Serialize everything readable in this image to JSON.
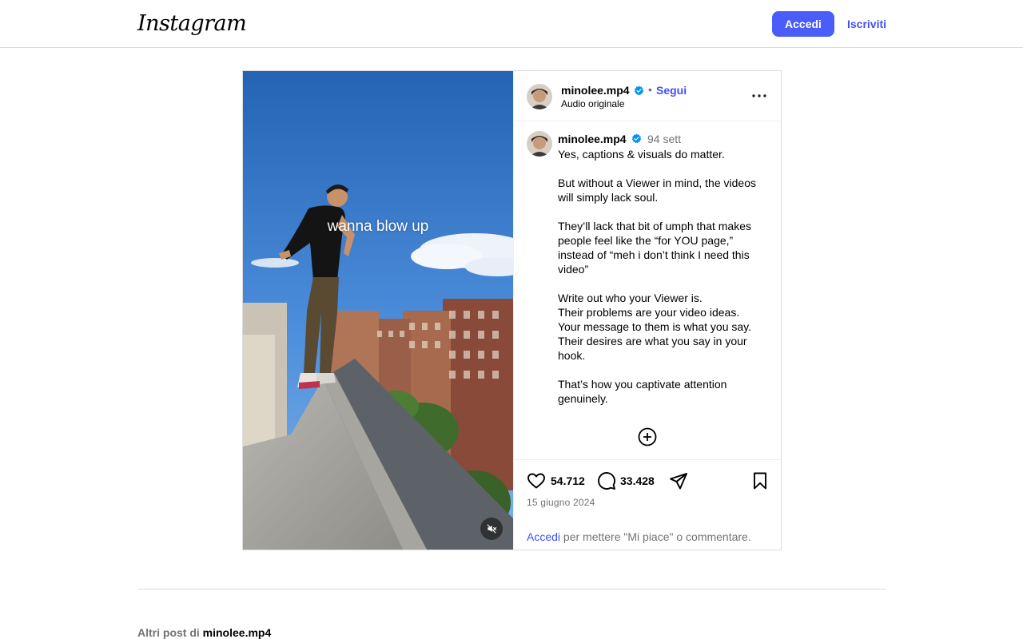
{
  "header": {
    "logo_text": "Instagram",
    "login_label": "Accedi",
    "signup_label": "Iscriviti"
  },
  "post": {
    "overlay_text": "wanna blow up",
    "author": {
      "username": "minolee.mp4",
      "verified": true,
      "follow_label": "Segui",
      "audio_label": "Audio originale"
    },
    "caption": {
      "username": "minolee.mp4",
      "time": "94 sett",
      "text": "Yes, captions & visuals do matter.\n\nBut without a Viewer in mind, the videos will simply lack soul.\n\nThey’ll lack that bit of umph that makes people feel like the “for YOU page,” instead of “meh i don’t think I need this video”\n\nWrite out who your Viewer is.\nTheir problems are your video ideas.\nYour message to them is what you say.\nTheir desires are what you say in your hook.\n\nThat’s how you captivate attention genuinely."
    },
    "likes": "54.712",
    "comments": "33.428",
    "date": "15 giugno 2024",
    "login_prompt": {
      "link": "Accedi",
      "rest": " per mettere \"Mi piace\" o commentare."
    }
  },
  "more_posts": {
    "prefix": "Altri post di ",
    "username": "minolee.mp4"
  },
  "colors": {
    "accent": "#4a5df9",
    "link": "#4150f7",
    "muted": "#737373",
    "verified": "#0095f6"
  }
}
